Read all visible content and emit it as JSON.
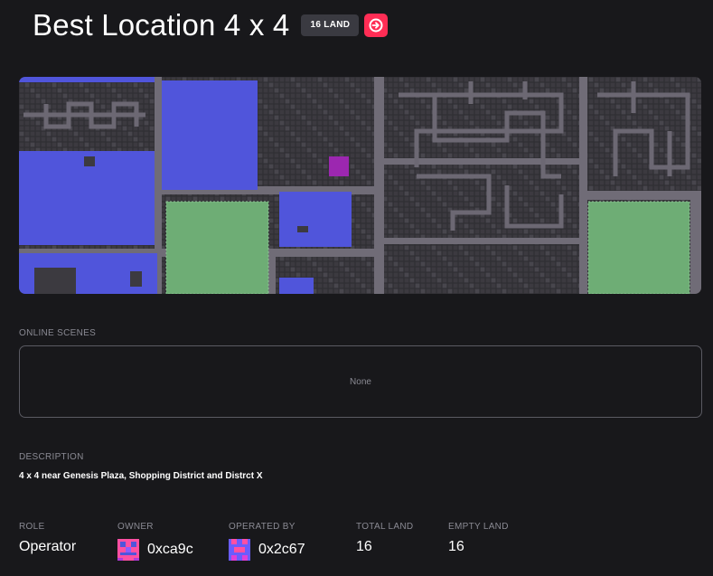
{
  "header": {
    "title": "Best Location 4 x 4",
    "land_badge": "16 LAND",
    "jump_icon": "arrow-right-circle-icon"
  },
  "colors": {
    "background": "#18181b",
    "accent": "#ff2d55",
    "map_owned": "#5055db",
    "map_plaza": "#6ead75",
    "map_selected": "#9c27b0",
    "map_road": "#706c77",
    "map_parcel": "#3c3a40"
  },
  "online_scenes": {
    "label": "ONLINE SCENES",
    "empty_text": "None"
  },
  "description": {
    "label": "DESCRIPTION",
    "text": "4 x 4 near Genesis Plaza, Shopping District and Distrct X"
  },
  "stats": {
    "role": {
      "label": "ROLE",
      "value": "Operator"
    },
    "owner": {
      "label": "OWNER",
      "address": "0xca9c",
      "avatar_icon": "pixel-avatar-icon"
    },
    "operated_by": {
      "label": "OPERATED BY",
      "address": "0x2c67",
      "avatar_icon": "pixel-avatar-icon"
    },
    "total_land": {
      "label": "TOTAL LAND",
      "value": "16"
    },
    "empty_land": {
      "label": "EMPTY LAND",
      "value": "16"
    }
  }
}
